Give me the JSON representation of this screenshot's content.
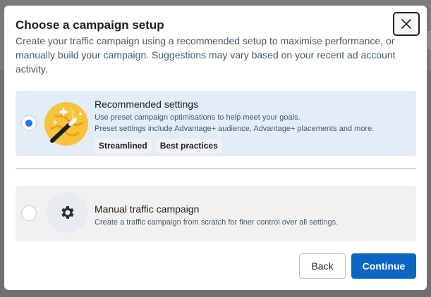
{
  "dialog": {
    "title": "Choose a campaign setup",
    "subtitle": "Create your traffic campaign using a recommended setup to maximise performance, or manually build your campaign. Suggestions may vary based on your recent ad account activity."
  },
  "options": [
    {
      "title": "Recommended settings",
      "desc1": "Use preset campaign optimisations to help meet your goals.",
      "desc2": "Preset settings include Advantage+ audience, Advantage+ placements and more.",
      "badges": [
        "Streamlined",
        "Best practices"
      ],
      "selected": true,
      "icon": "magic-wand-icon"
    },
    {
      "title": "Manual traffic campaign",
      "desc": "Create a traffic campaign from scratch for finer control over all settings.",
      "selected": false,
      "icon": "gear-icon"
    }
  ],
  "buttons": {
    "back": "Back",
    "continue": "Continue"
  },
  "colors": {
    "accent": "#0a66c2",
    "selected_bg": "#e2edf7",
    "unselected_bg": "#f1f1f1"
  }
}
